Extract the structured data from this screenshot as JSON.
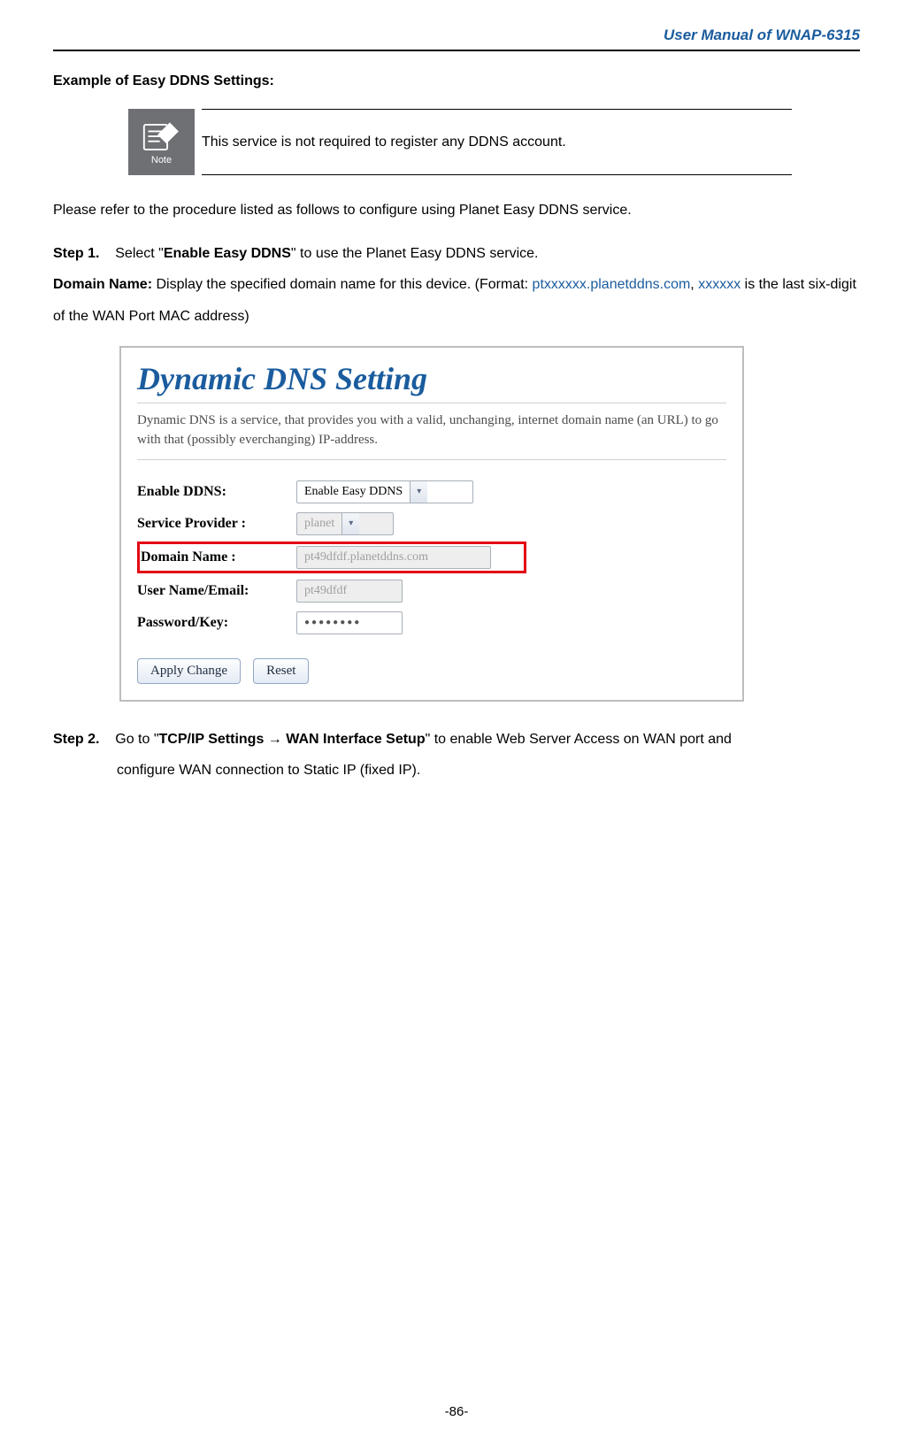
{
  "header": {
    "title": "User Manual of WNAP-6315"
  },
  "example_title": "Example of Easy DDNS Settings:",
  "note": {
    "label": "Note",
    "text": "This service is not required to register any DDNS account."
  },
  "intro": "Please refer to the procedure listed as follows to configure using Planet Easy DDNS service.",
  "step1": {
    "prefix": "Step 1.",
    "text_before": "Select \"",
    "bold": "Enable Easy DDNS",
    "text_after": "\" to use the Planet Easy DDNS service."
  },
  "domain_name_desc": {
    "label": "Domain Name:",
    "text_before": " Display the specified domain name for this device. (Format: ",
    "blue1": "ptxxxxxx.planetddns.com",
    "comma": ", ",
    "blue2": "xxxxxx",
    "text_after": " is the last six-digit of the WAN Port MAC address)"
  },
  "ddns_panel": {
    "title": "Dynamic DNS  Setting",
    "description": "Dynamic DNS is a service, that provides you with a valid, unchanging, internet domain name (an URL) to go with that (possibly everchanging) IP-address.",
    "rows": {
      "enable": {
        "label": "Enable DDNS:",
        "value": "Enable Easy DDNS"
      },
      "provider": {
        "label": "Service Provider :",
        "value": "planet"
      },
      "domain": {
        "label": "Domain Name :",
        "value": "pt49dfdf.planetddns.com"
      },
      "username": {
        "label": "User Name/Email:",
        "value": "pt49dfdf"
      },
      "password": {
        "label": "Password/Key:",
        "value": "●●●●●●●●"
      }
    },
    "buttons": {
      "apply": "Apply Change",
      "reset": "Reset"
    }
  },
  "step2": {
    "prefix": "Step 2.",
    "line1_before": "Go to \"",
    "bold1": "TCP/IP Settings ",
    "arrow": "→",
    "bold2": " WAN Interface Setup",
    "line1_after": "\" to enable Web Server Access on WAN port and",
    "line2": "configure WAN connection to Static IP (fixed IP)."
  },
  "footer": "-86-"
}
